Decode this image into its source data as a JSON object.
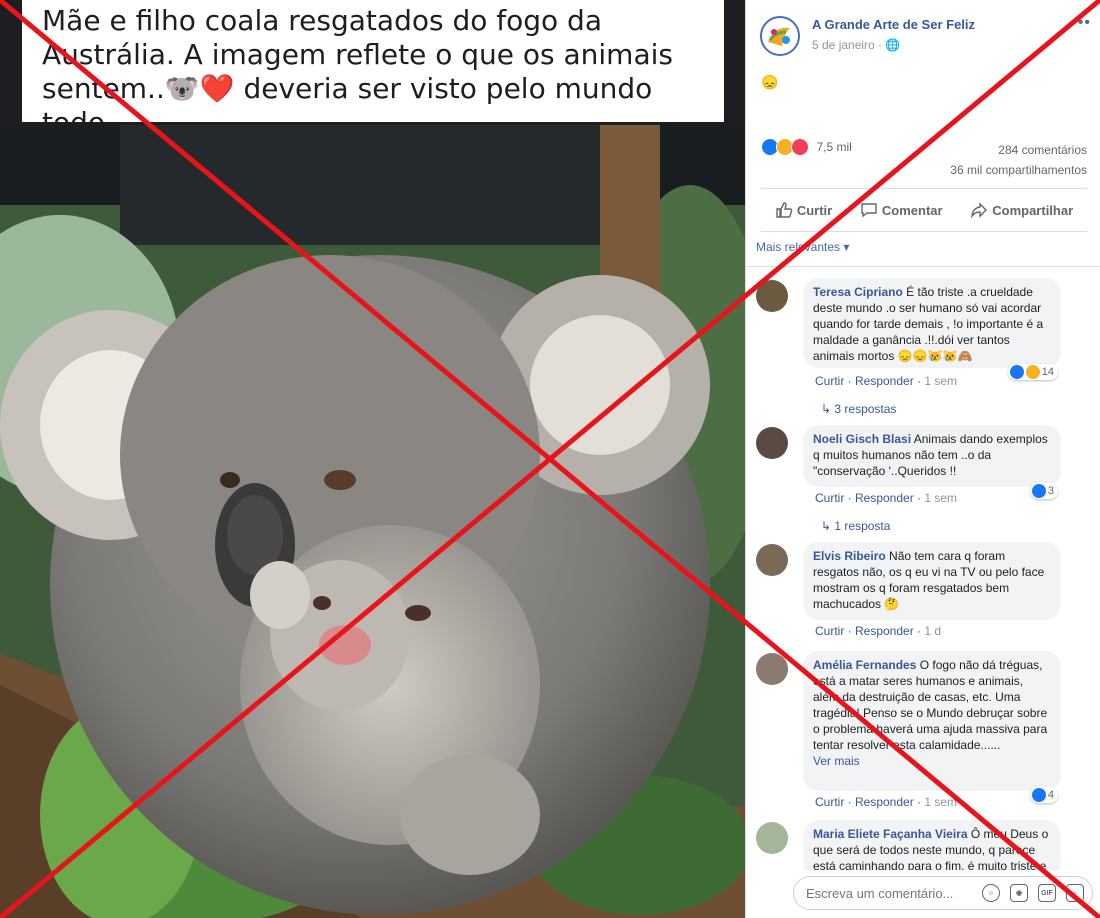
{
  "post": {
    "caption": "Mãe e filho coala resgatados do fogo da Austrália. A imagem reflete o que os animais sentem..🐨❤️ deveria ser visto pelo mundo todo",
    "page_name": "A Grande Arte de Ser Feliz",
    "date": "5 de janeiro · 🌐",
    "body_emoji": "😞",
    "more": "•••",
    "reactions_count": "7,5 mil",
    "comments_count": "284 comentários",
    "shares_count": "36 mil compartilhamentos",
    "actions": {
      "like": "Curtir",
      "comment": "Comentar",
      "share": "Compartilhar"
    },
    "relevance": "Mais relevantes ▾"
  },
  "comments": [
    {
      "name": "Teresa Cipriano",
      "text": "É tão triste .a crueldade deste mundo .o ser humano só vai acordar quando for tarde demais , !o importante é a maldade a ganância .!!.dói ver tantos animais mortos 😞😞😿😿🙈",
      "meta_actions": "Curtir · Responder · ",
      "time": "1 sem",
      "reactions": "14",
      "replies": "↳ 3 respostas"
    },
    {
      "name": "Noeli Gisch Blasi",
      "text": "Animais dando exemplos q muitos humanos não tem ..o da \"conservação '..Queridos !!",
      "meta_actions": "Curtir · Responder · ",
      "time": "1 sem",
      "reactions": "3",
      "replies": "↳ 1 resposta"
    },
    {
      "name": "Elvis Ribeiro",
      "text": "Não tem cara q foram resgatos não, os q eu vi na TV ou pelo face mostram os q foram resgatados bem machucados 🤔",
      "meta_actions": "Curtir · Responder · ",
      "time": "1 d"
    },
    {
      "name": "Amélia Fernandes",
      "text": "O fogo não dá tréguas, está a matar seres humanos e animais, além da destruição de casas, etc. Uma tragédia! Penso se o Mundo debruçar sobre o problema haverá uma ajuda massiva para tentar resolver esta calamidade......",
      "more": "Ver mais",
      "meta_actions": "Curtir · Responder · ",
      "time": "1 sem",
      "reactions": "4"
    },
    {
      "name": "Maria Eliete Façanha Vieira",
      "text": "Ô meu Deus o que será de todos neste mundo, q parece está caminhando para o fim, é muito triste e"
    }
  ],
  "composer": {
    "placeholder": "Escreva um comentário..."
  },
  "colors": {
    "link": "#385898",
    "like_blue": "#1877f2",
    "love_red": "#f33e58",
    "sad_yellow": "#f7b125",
    "cross_red": "#e8141c"
  }
}
